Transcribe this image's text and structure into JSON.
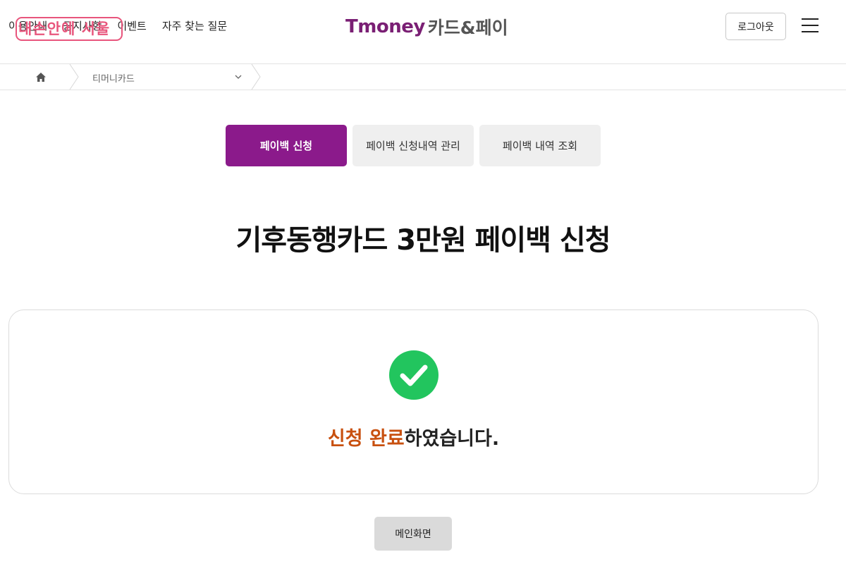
{
  "header": {
    "nav_items": [
      {
        "label": "이용안내"
      },
      {
        "label": "공지사항"
      },
      {
        "label": "이벤트"
      },
      {
        "label": "자주 찾는 질문"
      }
    ],
    "overlay_badge": "내손안에 서울",
    "logo_brand": "Tmoney",
    "logo_sub": "카드&페이",
    "logout_label": "로그아웃",
    "menu_icon": "hamburger-menu-icon"
  },
  "breadcrumb": {
    "home_icon": "home-icon",
    "current_label": "티머니카드"
  },
  "tabs": [
    {
      "label": "페이백 신청",
      "active": true
    },
    {
      "label": "페이백 신청내역 관리",
      "active": false
    },
    {
      "label": "페이백 내역 조회",
      "active": false
    }
  ],
  "page_title": "기후동행카드 3만원 페이백 신청",
  "result": {
    "icon": "check-circle-icon",
    "highlight": "신청 완료",
    "message_rest": "하였습니다."
  },
  "footer_button": {
    "label": "메인화면"
  },
  "colors": {
    "accent": "#8b1a8b",
    "success": "#22c55e",
    "highlight_text": "#c8500f",
    "badge": "#e8557c"
  }
}
